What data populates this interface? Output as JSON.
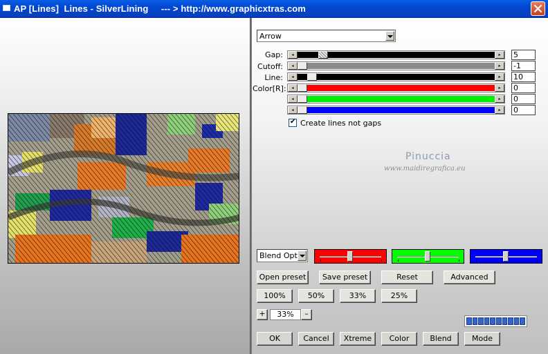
{
  "window": {
    "title": "AP [Lines]  Lines - SilverLining     --- > http://www.graphicxtras.com",
    "close_icon": "close-icon"
  },
  "preset_dropdown": {
    "value": "Arrow"
  },
  "sliders": [
    {
      "label": "Gap:",
      "value": "5",
      "track_color": "#000000"
    },
    {
      "label": "Cutoff:",
      "value": "-1",
      "track_color": "#8a8a8a"
    },
    {
      "label": "Line:",
      "value": "10",
      "track_color": "#000000"
    },
    {
      "label": "Color[R]:",
      "value": "0",
      "track_color": "#ff0000"
    },
    {
      "label": "",
      "value": "0",
      "track_color": "#00ee00"
    },
    {
      "label": "",
      "value": "0",
      "track_color": "#0000ff"
    }
  ],
  "checkbox": {
    "label": "Create lines not gaps",
    "checked": true
  },
  "watermark": {
    "line1": "Pinuccia",
    "line2": "www.maidiregrafica.eu"
  },
  "blend_dropdown": {
    "value": "Blend Optio"
  },
  "color_sliders": [
    {
      "name": "red",
      "color": "#ff0000"
    },
    {
      "name": "green",
      "color": "#00ff00"
    },
    {
      "name": "blue",
      "color": "#0000ff"
    }
  ],
  "buttons": {
    "open_preset": "Open preset",
    "save_preset": "Save preset",
    "reset": "Reset",
    "advanced": "Advanced",
    "zoom_100": "100%",
    "zoom_50": "50%",
    "zoom_33": "33%",
    "zoom_25": "25%",
    "plus": "+",
    "minus": "–",
    "ok": "OK",
    "cancel": "Cancel",
    "xtreme": "Xtreme",
    "color": "Color",
    "blend": "Blend",
    "mode": "Mode"
  },
  "zoom_field": "33%",
  "progress_blocks": 10
}
